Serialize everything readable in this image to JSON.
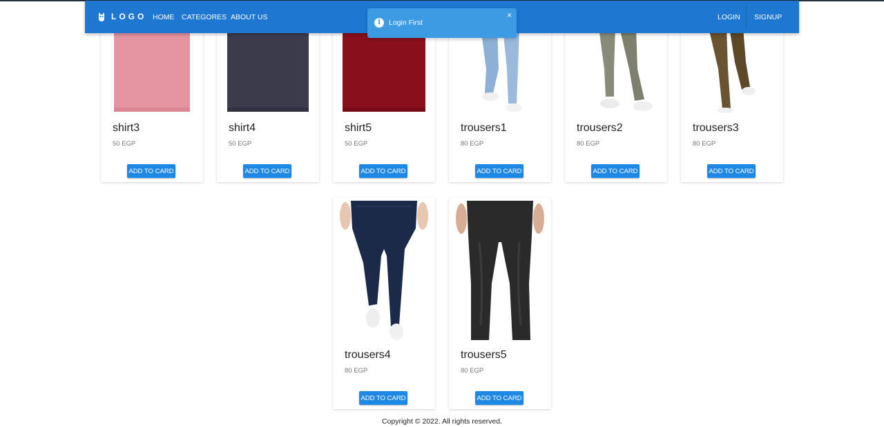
{
  "navbar": {
    "logo_text": "LOGO",
    "links": [
      "HOME",
      "CATEGORES",
      "ABOUT US"
    ],
    "login": "LOGIN",
    "signup": "SIGNUP"
  },
  "toast": {
    "message": "Login First",
    "close": "×"
  },
  "products": [
    {
      "name": "shirt3",
      "price": "50 EGP",
      "button": "ADD TO CARD",
      "color": "#e595a1"
    },
    {
      "name": "shirt4",
      "price": "50 EGP",
      "button": "ADD TO CARD",
      "color": "#3b3b4c"
    },
    {
      "name": "shirt5",
      "price": "50 EGP",
      "button": "ADD TO CARD",
      "color": "#8a0f1c"
    },
    {
      "name": "trousers1",
      "price": "80 EGP",
      "button": "ADD TO CARD",
      "color": "#8fb0d6"
    },
    {
      "name": "trousers2",
      "price": "80 EGP",
      "button": "ADD TO CARD",
      "color": "#8a8a78"
    },
    {
      "name": "trousers3",
      "price": "80 EGP",
      "button": "ADD TO CARD",
      "color": "#6a5330"
    },
    {
      "name": "trousers4",
      "price": "80 EGP",
      "button": "ADD TO CARD",
      "color": "#1c2a4a"
    },
    {
      "name": "trousers5",
      "price": "80 EGP",
      "button": "ADD TO CARD",
      "color": "#2a2a2a"
    }
  ],
  "footer": "Copyright © 2022. All rights reserved."
}
